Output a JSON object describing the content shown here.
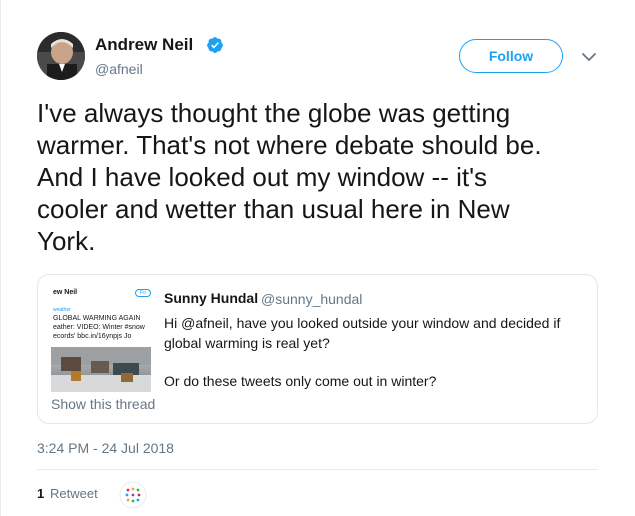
{
  "author": {
    "name": "Andrew Neil",
    "handle": "@afneil",
    "verified": true
  },
  "follow_label": "Follow",
  "tweet_lines": [
    "I've always thought the globe was getting",
    "warmer. That's not where debate should be.",
    "And I have looked out my window -- it's",
    "cooler and wetter than usual here in New",
    "York."
  ],
  "quote": {
    "name": "Sunny Hundal",
    "handle": "@sunny_hundal",
    "text_1": "Hi @afneil, have you looked outside your window and decided if global warming is real yet?",
    "text_2": "Or do these tweets only come out in winter?",
    "show_thread": "Show this thread",
    "thumb": {
      "author_snip": "ew Neil",
      "follow_snip": "Fo",
      "l1": "weather",
      "l2": "GLOBAL WARMING AGAIN",
      "l3": "eather: VIDEO: Winter #snow",
      "l4": "ecords' bbc.in/16ynpjs Jo"
    }
  },
  "timestamp": "3:24 PM - 24 Jul 2018",
  "stats": {
    "retweet_count": "1",
    "retweet_label": "Retweet"
  },
  "colors": {
    "accent": "#1da1f2",
    "muted": "#657786",
    "text": "#14171a",
    "border": "#e1e8ed"
  },
  "icons": {
    "verified": "verified-badge-icon",
    "caret": "chevron-down-icon"
  }
}
